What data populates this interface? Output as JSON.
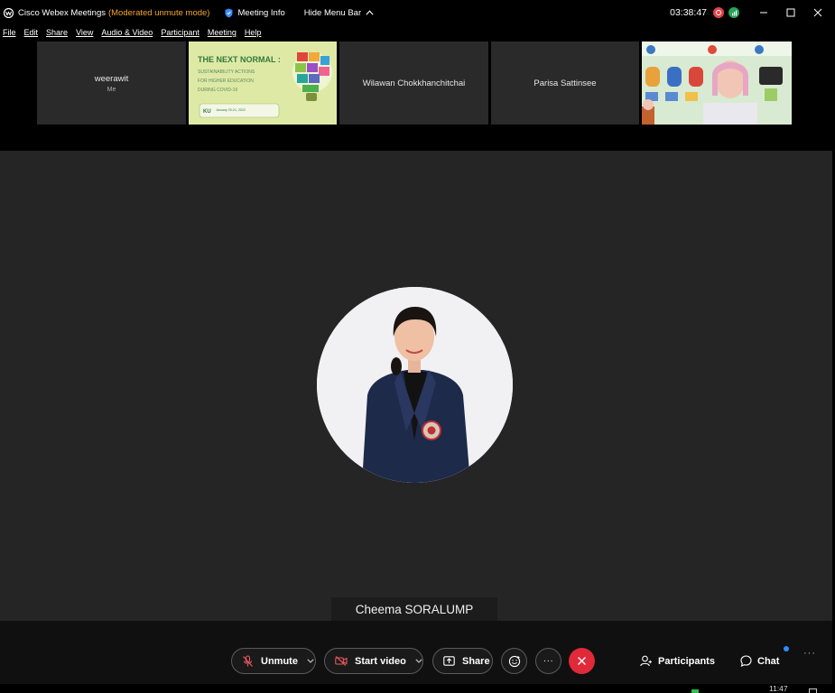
{
  "window": {
    "app_title": "Cisco Webex Meetings",
    "mode": "(Moderated unmute mode)",
    "meeting_info": "Meeting Info",
    "hide_menu": "Hide Menu Bar",
    "clock": "03:38:47"
  },
  "menu": [
    "File",
    "Edit",
    "Share",
    "View",
    "Audio & Video",
    "Participant",
    "Meeting",
    "Help"
  ],
  "thumbnails": [
    {
      "name": "weerawit",
      "sub": "Me"
    },
    {
      "slide": {
        "title": "THE NEXT NORMAL :",
        "lines": [
          "SUSTAINABILITY ACTIONS",
          "FOR HIGHER EDUCATION",
          "DURING COVID-19"
        ],
        "logo": "KU",
        "date": "January 20-21, 2022"
      }
    },
    {
      "name": "Wilawan Chokkhanchitchai"
    },
    {
      "name": "Parisa Sattinsee"
    },
    {
      "video": "participant-video"
    }
  ],
  "speaker": {
    "name": "Cheema SORALUMP"
  },
  "controls": {
    "unmute": "Unmute",
    "start_video": "Start video",
    "share": "Share",
    "more": "···",
    "participants": "Participants",
    "chat": "Chat",
    "overflow": "···"
  },
  "taskbar": {
    "time": "11:47"
  },
  "colors": {
    "mode_text": "#f4a534",
    "end_button": "#e02a3a",
    "record": "#e0434b",
    "network": "#27a35a",
    "chat_badge": "#2d8cff"
  }
}
